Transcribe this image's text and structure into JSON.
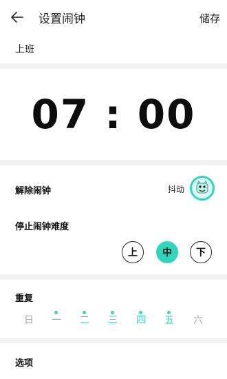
{
  "header": {
    "title": "设置闹钟",
    "save_label": "储存"
  },
  "alarm": {
    "name": "上班",
    "time": "07 : 00"
  },
  "dismiss": {
    "label": "解除闹钟",
    "method": "抖动",
    "icon": "monster-icon"
  },
  "difficulty": {
    "label": "停止闹钟难度",
    "options": [
      "上",
      "中",
      "下"
    ],
    "selected": "中"
  },
  "repeat": {
    "label": "重复",
    "days": [
      {
        "label": "日",
        "on": false
      },
      {
        "label": "一",
        "on": true
      },
      {
        "label": "二",
        "on": true
      },
      {
        "label": "三",
        "on": true
      },
      {
        "label": "四",
        "on": true
      },
      {
        "label": "五",
        "on": true
      },
      {
        "label": "六",
        "on": false
      }
    ]
  },
  "options": {
    "label": "选项"
  },
  "colors": {
    "accent": "#2fd6bb",
    "background": "#f2f2f2",
    "inactive": "#aaaaaa"
  }
}
